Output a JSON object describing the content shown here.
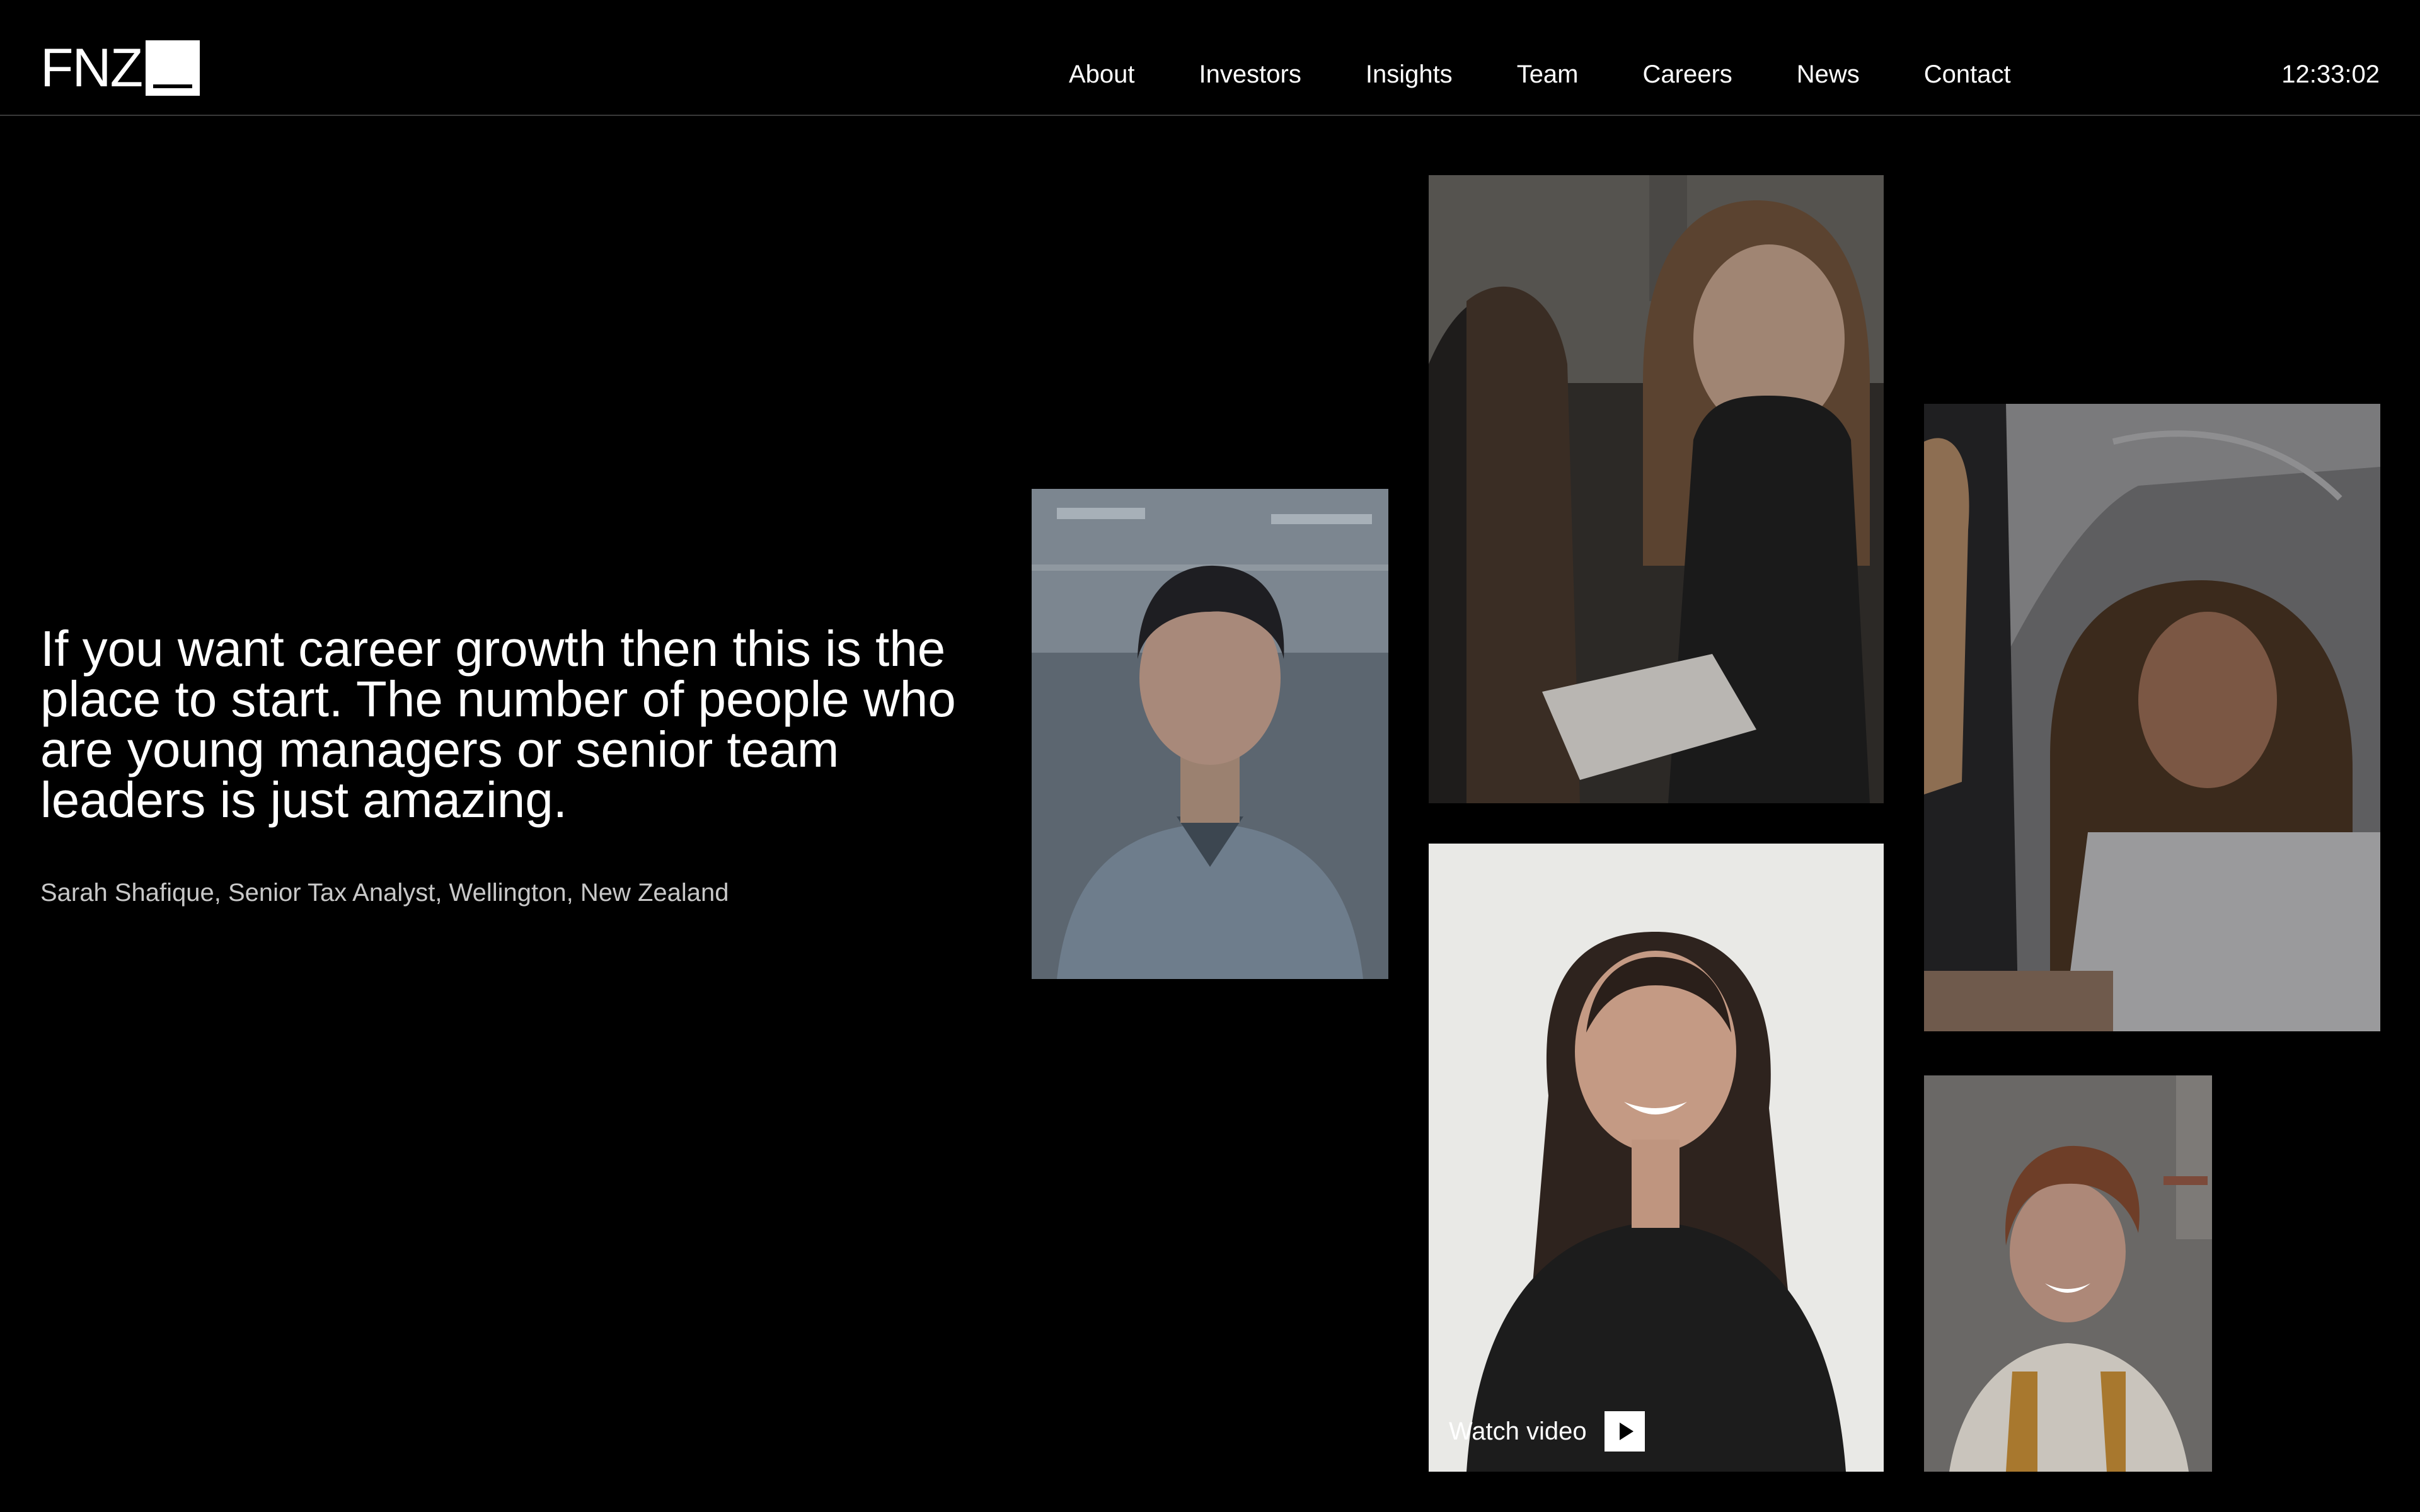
{
  "header": {
    "logo_text": "FNZ",
    "nav": [
      {
        "label": "About"
      },
      {
        "label": "Investors"
      },
      {
        "label": "Insights"
      },
      {
        "label": "Team"
      },
      {
        "label": "Careers"
      },
      {
        "label": "News"
      },
      {
        "label": "Contact"
      }
    ],
    "clock": "12:33:02"
  },
  "testimonial": {
    "quote": "If you want career growth then this is the place to start. The number of people who are young managers or senior team leaders is just amazing.",
    "attribution": "Sarah Shafique, Senior Tax Analyst, Wellington, New Zealand"
  },
  "video": {
    "label": "Watch video",
    "icon": "play-icon"
  },
  "colors": {
    "background": "#000000",
    "text": "#ffffff",
    "muted_text": "#c8c8c8",
    "divider": "#3a3a3a"
  }
}
